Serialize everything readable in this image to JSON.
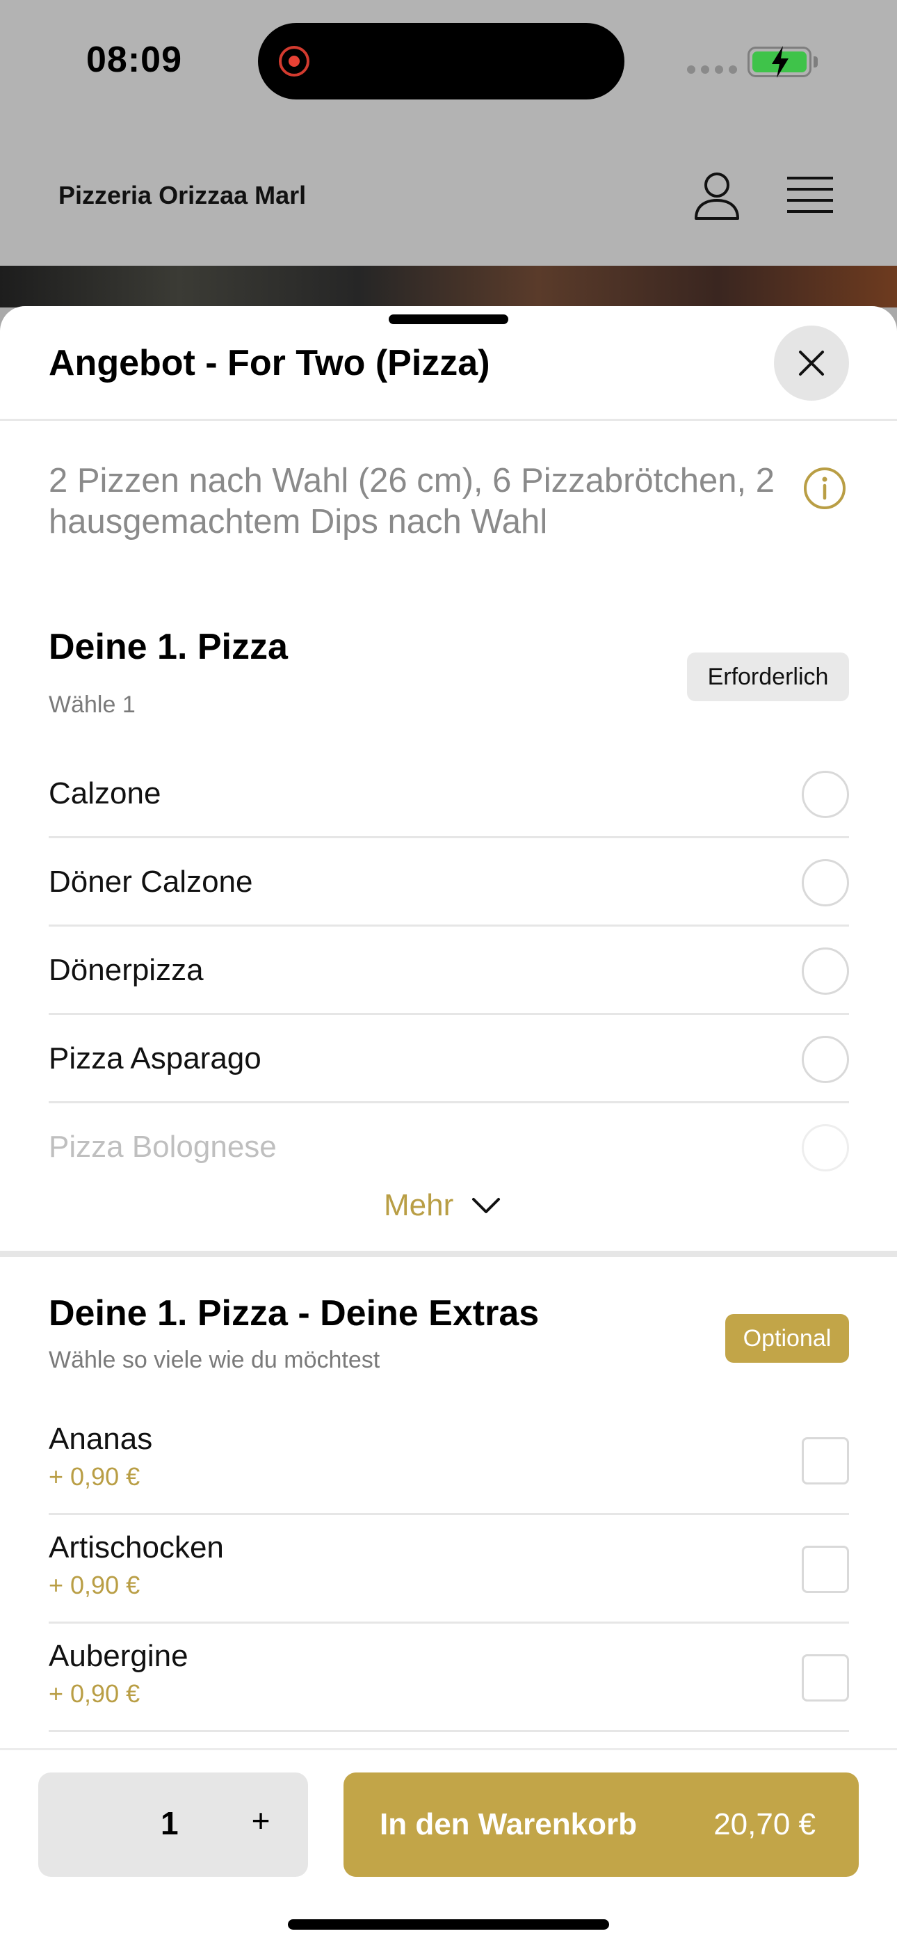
{
  "status_bar": {
    "time": "08:09"
  },
  "header": {
    "restaurant_name": "Pizzeria Orizzaa Marl"
  },
  "sheet": {
    "title": "Angebot - For Two (Pizza)",
    "description": "2 Pizzen nach Wahl (26 cm), 6 Pizzabrötchen, 2 hausgemachtem Dips nach Wahl"
  },
  "section1": {
    "title": "Deine 1. Pizza",
    "subtitle": "Wähle 1",
    "badge": "Erforderlich",
    "options": [
      {
        "label": "Calzone"
      },
      {
        "label": "Döner Calzone"
      },
      {
        "label": "Dönerpizza"
      },
      {
        "label": "Pizza Asparago"
      },
      {
        "label": "Pizza Bolognese"
      }
    ],
    "more_label": "Mehr"
  },
  "section2": {
    "title": "Deine 1. Pizza - Deine Extras",
    "subtitle": "Wähle so viele wie du möchtest",
    "badge": "Optional",
    "extras": [
      {
        "label": "Ananas",
        "price": "+ 0,90 €"
      },
      {
        "label": "Artischocken",
        "price": "+ 0,90 €"
      },
      {
        "label": "Aubergine",
        "price": "+ 0,90 €"
      }
    ]
  },
  "bottom_bar": {
    "quantity": "1",
    "plus_label": "+",
    "cart_label": "In den Warenkorb",
    "cart_price": "20,70 €"
  },
  "colors": {
    "accent": "#c2a548",
    "battery": "#3fc34a",
    "record": "#e84235"
  }
}
